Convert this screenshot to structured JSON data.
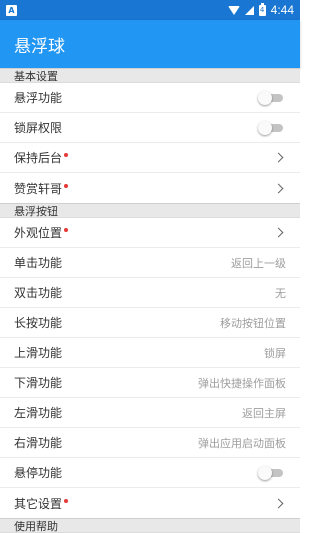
{
  "status_bar": {
    "app_icon_letter": "A",
    "battery_level": "4",
    "time": "4:44"
  },
  "app_bar": {
    "title": "悬浮球"
  },
  "sections": {
    "basic": {
      "title": "基本设置",
      "float_function": "悬浮功能",
      "lock_permission": "锁屏权限",
      "keep_background": "保持后台",
      "reward": "赞赏轩哥"
    },
    "buttons": {
      "title": "悬浮按钮",
      "appearance": "外观位置",
      "single_tap": {
        "label": "单击功能",
        "value": "返回上一级"
      },
      "double_tap": {
        "label": "双击功能",
        "value": "无"
      },
      "long_press": {
        "label": "长按功能",
        "value": "移动按钮位置"
      },
      "swipe_up": {
        "label": "上滑功能",
        "value": "锁屏"
      },
      "swipe_down": {
        "label": "下滑功能",
        "value": "弹出快捷操作面板"
      },
      "swipe_left": {
        "label": "左滑功能",
        "value": "返回主屏"
      },
      "swipe_right": {
        "label": "右滑功能",
        "value": "弹出应用启动面板"
      },
      "hover": "悬停功能",
      "other": "其它设置"
    },
    "help": {
      "title": "使用帮助"
    }
  },
  "colors": {
    "status_bar": "#1976d2",
    "app_bar": "#2196f3",
    "badge_dot": "#e53935"
  },
  "toggles": {
    "float_function": false,
    "lock_permission": false,
    "hover": false
  }
}
